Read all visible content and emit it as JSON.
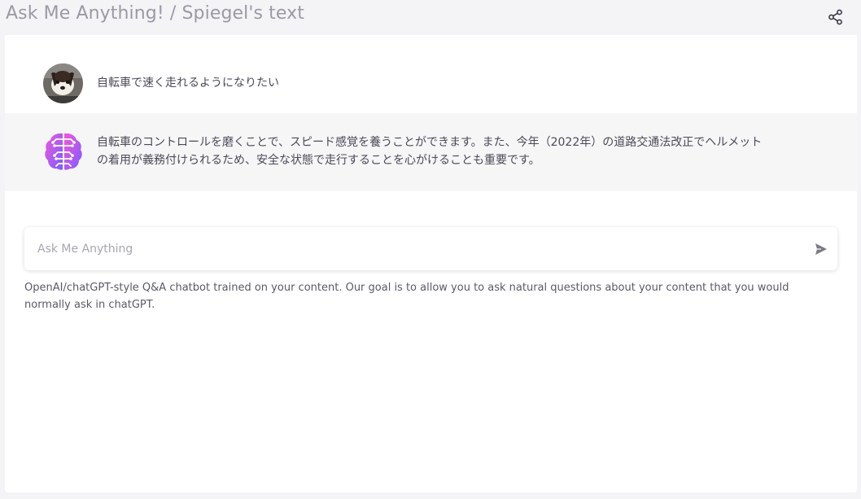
{
  "header": {
    "title": "Ask Me Anything! / Spiegel's text",
    "share_icon": "share-icon"
  },
  "conversation": {
    "user_message": "自転車で速く走れるようになりたい",
    "bot_message_line1": "自転車のコントロールを磨くことで、スピード感覚を養うことができます。また、今年（2022年）の道路交通法改正でヘルメット",
    "bot_message_line2": "の着用が義務付けられるため、安全な状態で走行することを心がけることも重要です。",
    "user_avatar_icon": "dog-avatar",
    "bot_avatar_icon": "brain-icon"
  },
  "composer": {
    "placeholder": "Ask Me Anything",
    "send_icon": "send-icon"
  },
  "footnote": {
    "text": "OpenAI/chatGPT-style Q&A chatbot trained on your content. Our goal is to allow you to ask natural questions about your content that you would normally ask in chatGPT."
  },
  "colors": {
    "background": "#f4f4f6",
    "panel": "#ffffff",
    "bot_row": "#f6f6f7",
    "brain_gradient_start": "#f05ad6",
    "brain_gradient_end": "#7b5cff"
  }
}
